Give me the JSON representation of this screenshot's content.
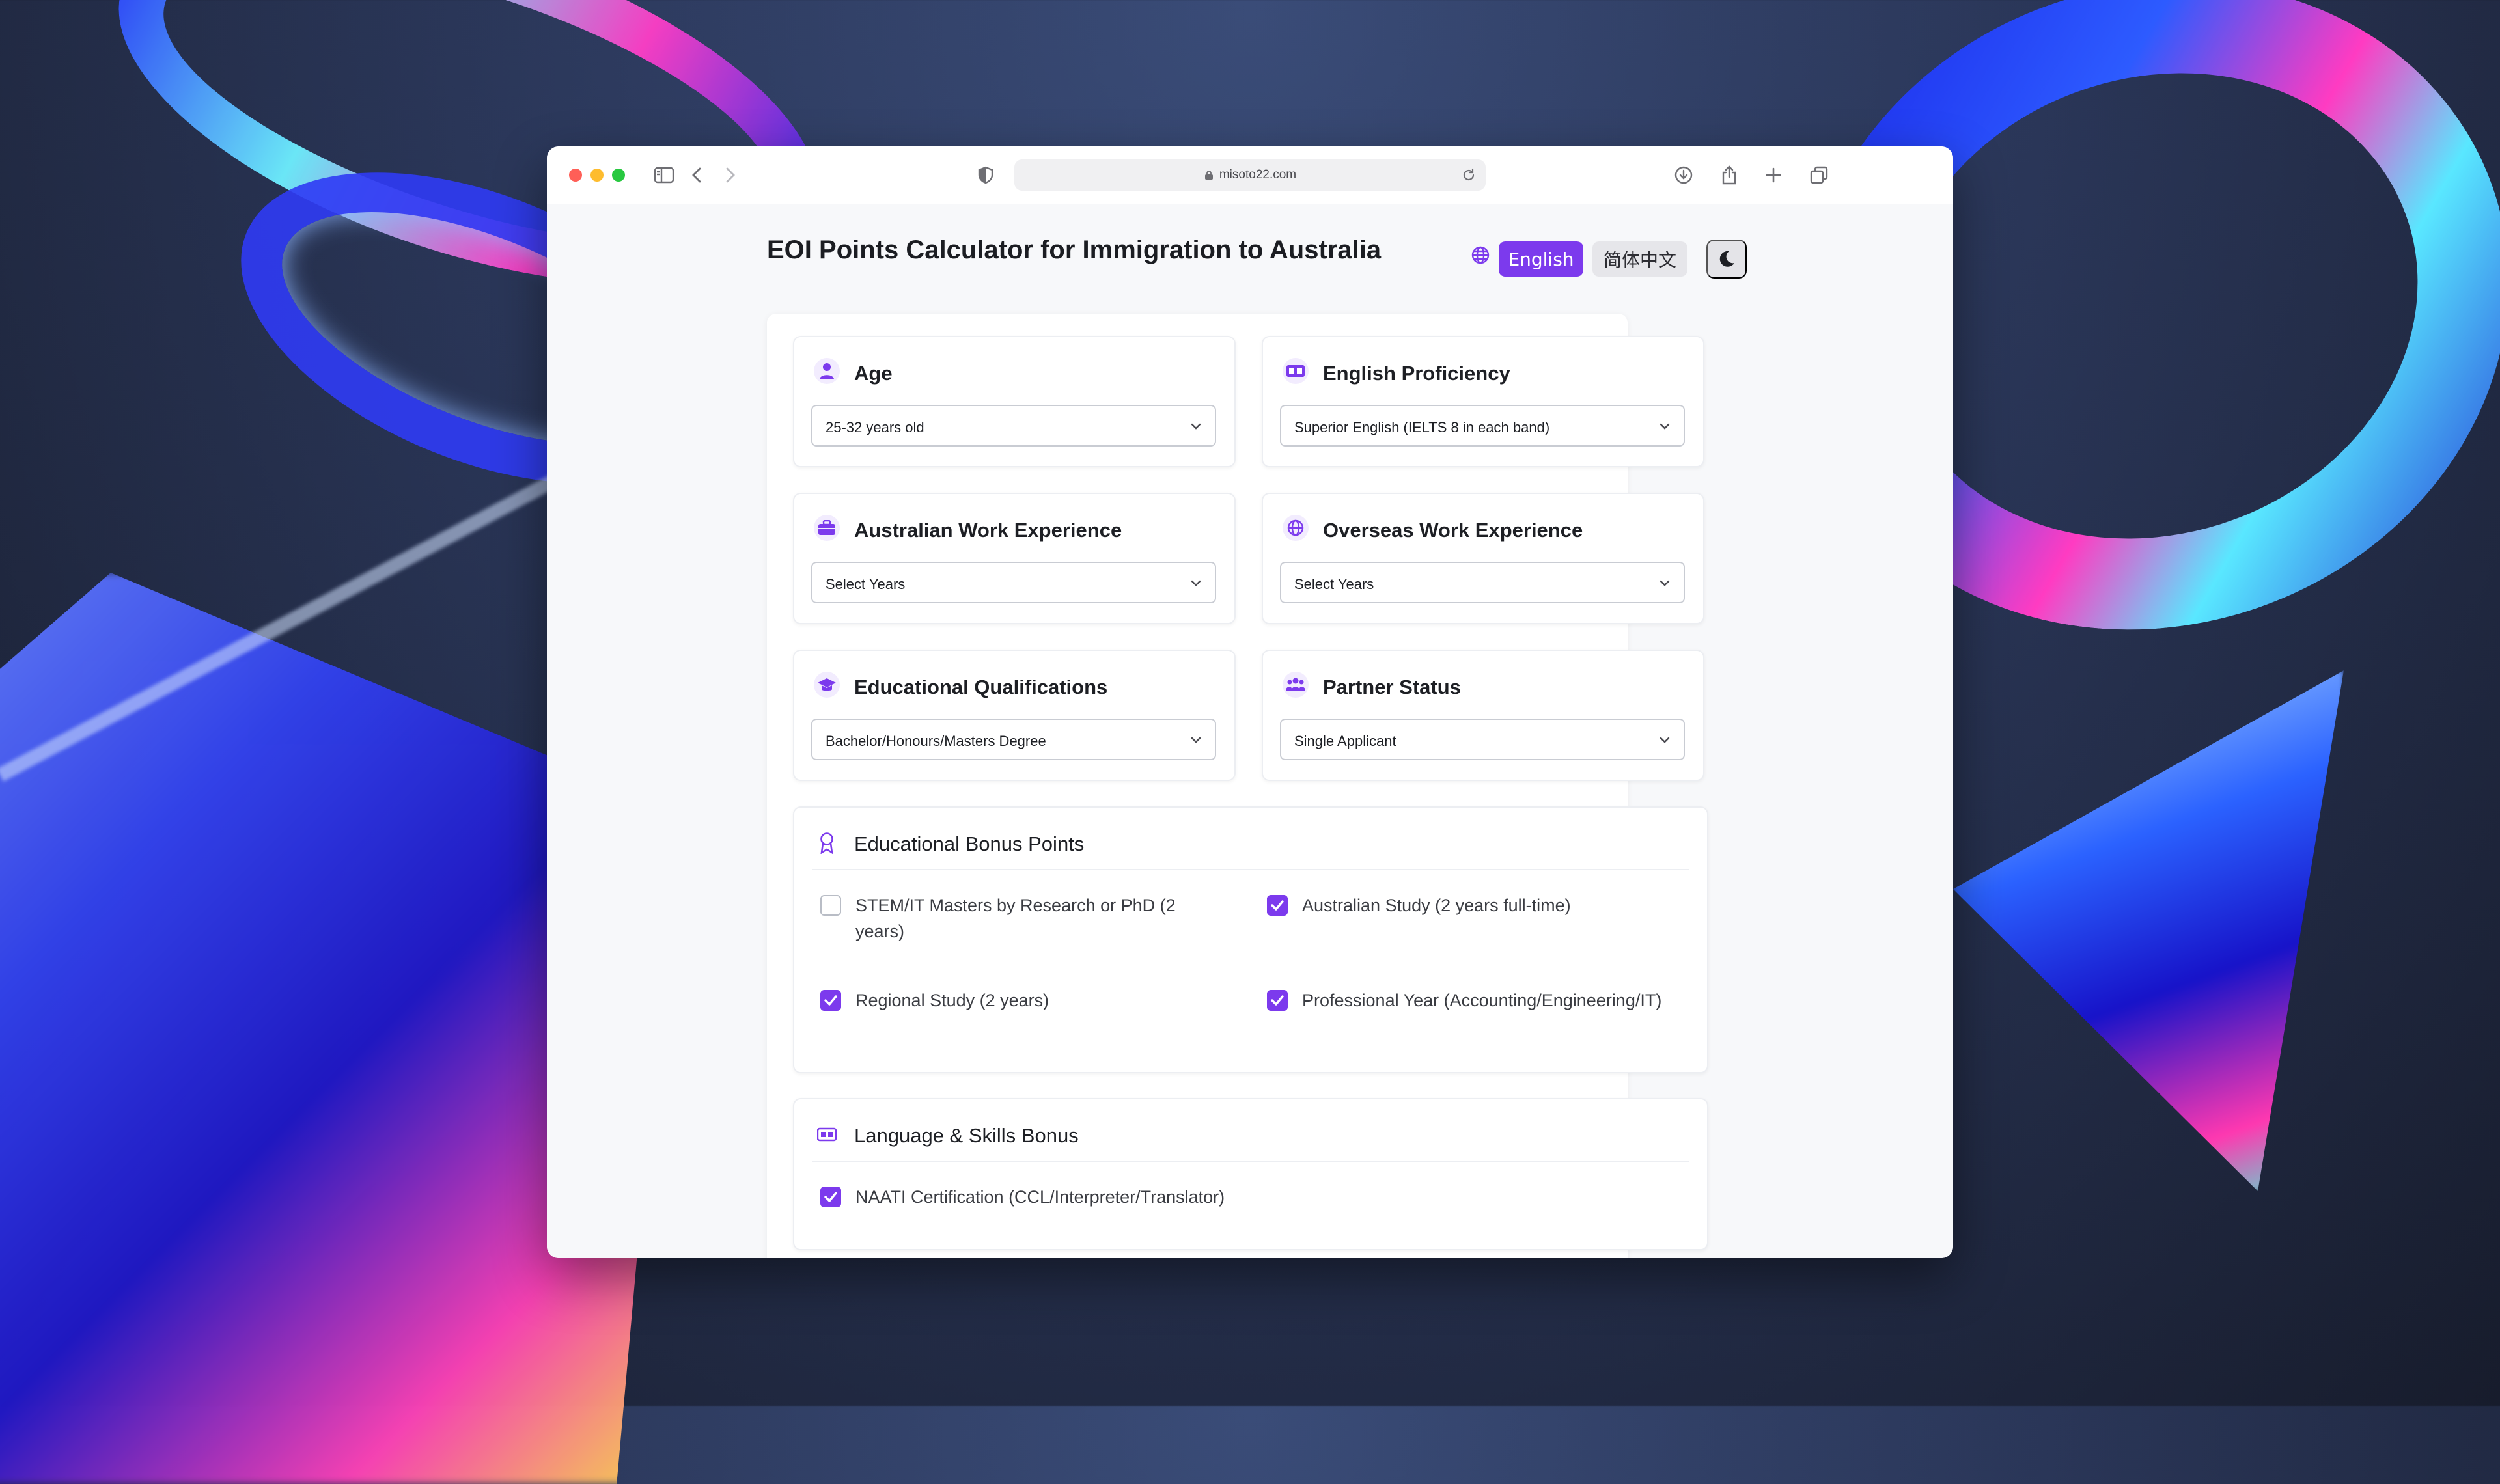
{
  "browser": {
    "url": "misoto22.com"
  },
  "header": {
    "title": "EOI Points Calculator for Immigration to Australia",
    "language_english": "English",
    "language_chinese": "简体中文"
  },
  "fields": {
    "age": {
      "label": "Age",
      "value": "25-32 years old",
      "icon": "user-icon"
    },
    "english": {
      "label": "English Proficiency",
      "value": "Superior English (IELTS 8 in each band)",
      "icon": "language-icon"
    },
    "au_work": {
      "label": "Australian Work Experience",
      "value": "Select Years",
      "icon": "briefcase-icon"
    },
    "overseas_work": {
      "label": "Overseas Work Experience",
      "value": "Select Years",
      "icon": "globe-icon"
    },
    "education": {
      "label": "Educational Qualifications",
      "value": "Bachelor/Honours/Masters Degree",
      "icon": "graduation-cap-icon"
    },
    "partner": {
      "label": "Partner Status",
      "value": "Single Applicant",
      "icon": "users-icon"
    }
  },
  "education_bonus": {
    "title": "Educational Bonus Points",
    "items": [
      {
        "label": "STEM/IT Masters by Research or PhD (2 years)",
        "checked": false
      },
      {
        "label": "Australian Study (2 years full-time)",
        "checked": true
      },
      {
        "label": "Regional Study (2 years)",
        "checked": true
      },
      {
        "label": "Professional Year (Accounting/Engineering/IT)",
        "checked": true
      }
    ]
  },
  "language_bonus": {
    "title": "Language & Skills Bonus",
    "items": [
      {
        "label": "NAATI Certification (CCL/Interpreter/Translator)",
        "checked": true
      }
    ]
  },
  "colors": {
    "accent": "#7c3aed",
    "page_bg": "#f7f8fa",
    "traffic_red": "#ff5f57",
    "traffic_yellow": "#febc2e",
    "traffic_green": "#28c840"
  }
}
